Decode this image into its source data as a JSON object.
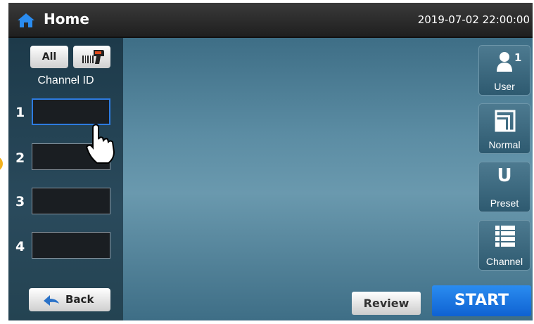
{
  "header": {
    "title": "Home",
    "datetime": "2019-07-02 22:00:00"
  },
  "left_panel": {
    "all_label": "All",
    "channel_id_label": "Channel ID",
    "rows": [
      {
        "number": "1",
        "value": "",
        "active": true
      },
      {
        "number": "2",
        "value": ""
      },
      {
        "number": "3",
        "value": ""
      },
      {
        "number": "4",
        "value": ""
      }
    ],
    "back_label": "Back"
  },
  "side_buttons": {
    "user": {
      "label": "User",
      "count": "1"
    },
    "normal": {
      "label": "Normal"
    },
    "preset": {
      "label": "Preset",
      "glyph": "U"
    },
    "channel": {
      "label": "Channel"
    }
  },
  "footer": {
    "review_label": "Review",
    "start_label": "START"
  },
  "colors": {
    "accent": "#2d7be0",
    "start_button": "#1a78e6",
    "home_icon": "#2a8cf0",
    "indicator": "#f3b21e"
  },
  "icons": [
    "home-icon",
    "barcode-scanner-icon",
    "hand-pointer-icon",
    "back-arrow-icon",
    "user-icon",
    "normal-mode-icon",
    "channel-list-icon"
  ]
}
